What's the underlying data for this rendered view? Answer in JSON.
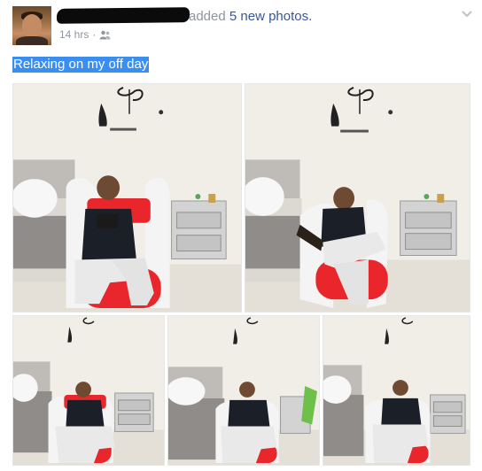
{
  "post": {
    "action_text": "added",
    "photo_count_label": "5 new photos.",
    "timestamp": "14 hrs",
    "separator": "·",
    "audience_icon": "friends-icon",
    "caption": "Relaxing on my off day",
    "options_icon": "chevron-down-icon"
  },
  "photos": [
    {
      "scene": "reading-in-chair"
    },
    {
      "scene": "legs-crossed-reclining"
    },
    {
      "scene": "reclining-eyes-closed"
    },
    {
      "scene": "reclining-eyes-closed"
    },
    {
      "scene": "reclining-eyes-closed"
    }
  ],
  "colors": {
    "link_blue": "#365899",
    "meta_gray": "#90949c",
    "caption_highlight": "#3a8ef0",
    "chair_red": "#e8262b",
    "chair_white": "#f4f4f4"
  }
}
